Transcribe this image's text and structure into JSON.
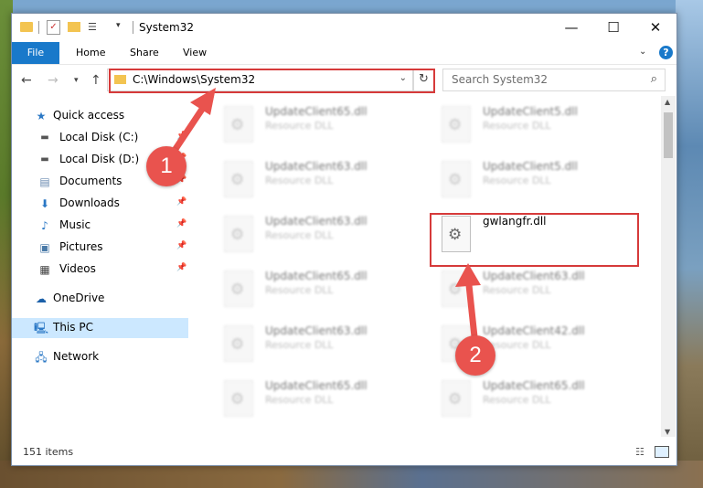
{
  "window": {
    "title": "System32"
  },
  "ribbon": {
    "file": "File",
    "home": "Home",
    "share": "Share",
    "view": "View"
  },
  "address": {
    "path": "C:\\Windows\\System32",
    "search_placeholder": "Search System32"
  },
  "nav": {
    "items": [
      {
        "label": "Quick access",
        "icon": "star-icon"
      },
      {
        "label": "Local Disk (C:)",
        "icon": "drive-icon"
      },
      {
        "label": "Local Disk (D:)",
        "icon": "drive-icon"
      },
      {
        "label": "Documents",
        "icon": "documents-icon"
      },
      {
        "label": "Downloads",
        "icon": "download-icon"
      },
      {
        "label": "Music",
        "icon": "music-icon"
      },
      {
        "label": "Pictures",
        "icon": "pictures-icon"
      },
      {
        "label": "Videos",
        "icon": "videos-icon"
      },
      {
        "label": "OneDrive",
        "icon": "cloud-icon"
      },
      {
        "label": "This PC",
        "icon": "computer-icon"
      },
      {
        "label": "Network",
        "icon": "network-icon"
      }
    ]
  },
  "files": {
    "left": [
      {
        "name": "UpdateClient65.dll",
        "type": "Resource DLL"
      },
      {
        "name": "UpdateClient63.dll",
        "type": "Resource DLL"
      },
      {
        "name": "UpdateClient63.dll",
        "type": "Resource DLL"
      },
      {
        "name": "UpdateClient65.dll",
        "type": "Resource DLL"
      },
      {
        "name": "UpdateClient63.dll",
        "type": "Resource DLL"
      },
      {
        "name": "UpdateClient65.dll",
        "type": "Resource DLL"
      }
    ],
    "right": [
      {
        "name": "UpdateClient5.dll",
        "type": "Resource DLL"
      },
      {
        "name": "UpdateClient5.dll",
        "type": "Resource DLL"
      },
      {
        "name": "gwlangfr.dll",
        "type": ""
      },
      {
        "name": "UpdateClient63.dll",
        "type": "Resource DLL"
      },
      {
        "name": "UpdateClient42.dll",
        "type": "Resource DLL"
      },
      {
        "name": "UpdateClient65.dll",
        "type": "Resource DLL"
      }
    ]
  },
  "status": {
    "count": "151 items"
  },
  "annotations": {
    "step1": "1",
    "step2": "2",
    "color": "#e9534e"
  }
}
